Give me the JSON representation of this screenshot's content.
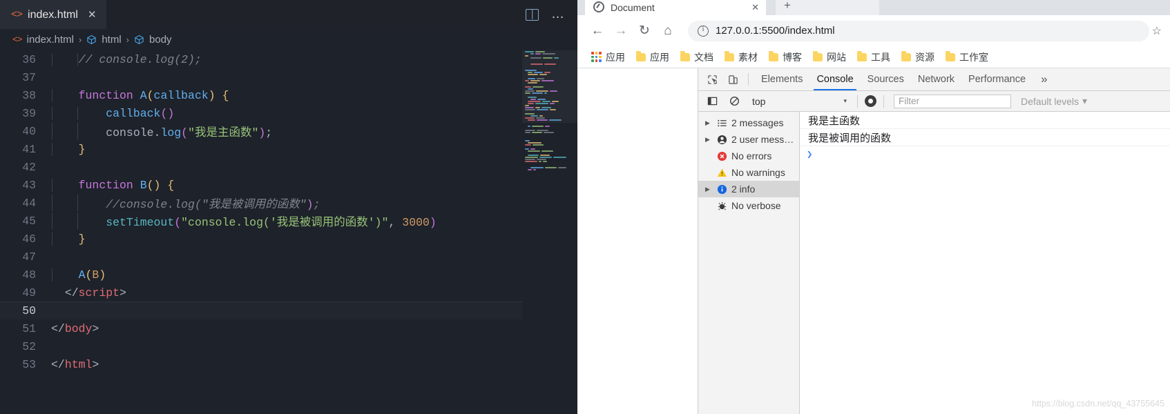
{
  "vscode": {
    "tab": {
      "label": "index.html",
      "icon": "html-file-icon",
      "close": "✕"
    },
    "actions": {
      "split": "split-editor-icon",
      "more": "…"
    },
    "breadcrumb": {
      "file": "index.html",
      "html": "html",
      "body": "body",
      "sep": "›"
    },
    "code_lines": [
      {
        "n": "36",
        "active": false,
        "indent_guides": 2,
        "tokens": [
          {
            "t": "    ",
            "c": "t-plain"
          },
          {
            "t": "// console.log(2);",
            "c": "t-com"
          }
        ]
      },
      {
        "n": "37",
        "active": false,
        "indent_guides": 0,
        "tokens": []
      },
      {
        "n": "38",
        "active": false,
        "indent_guides": 1,
        "tokens": [
          {
            "t": "    ",
            "c": "t-plain"
          },
          {
            "t": "function",
            "c": "t-key"
          },
          {
            "t": " ",
            "c": "t-plain"
          },
          {
            "t": "A",
            "c": "t-fn"
          },
          {
            "t": "(",
            "c": "t-par-y"
          },
          {
            "t": "callback",
            "c": "t-fn"
          },
          {
            "t": ")",
            "c": "t-par-y"
          },
          {
            "t": " ",
            "c": "t-plain"
          },
          {
            "t": "{",
            "c": "t-brace-y"
          }
        ]
      },
      {
        "n": "39",
        "active": false,
        "indent_guides": 2,
        "tokens": [
          {
            "t": "        ",
            "c": "t-plain"
          },
          {
            "t": "callback",
            "c": "t-fn"
          },
          {
            "t": "()",
            "c": "t-mag"
          }
        ]
      },
      {
        "n": "40",
        "active": false,
        "indent_guides": 2,
        "tokens": [
          {
            "t": "        ",
            "c": "t-plain"
          },
          {
            "t": "console",
            "c": "t-plain"
          },
          {
            "t": ".",
            "c": "t-plain"
          },
          {
            "t": "log",
            "c": "t-fn"
          },
          {
            "t": "(",
            "c": "t-mag"
          },
          {
            "t": "\"我是主函数\"",
            "c": "t-str"
          },
          {
            "t": ")",
            "c": "t-mag"
          },
          {
            "t": ";",
            "c": "t-plain"
          }
        ]
      },
      {
        "n": "41",
        "active": false,
        "indent_guides": 1,
        "tokens": [
          {
            "t": "    ",
            "c": "t-plain"
          },
          {
            "t": "}",
            "c": "t-brace-y"
          }
        ]
      },
      {
        "n": "42",
        "active": false,
        "indent_guides": 0,
        "tokens": []
      },
      {
        "n": "43",
        "active": false,
        "indent_guides": 1,
        "tokens": [
          {
            "t": "    ",
            "c": "t-plain"
          },
          {
            "t": "function",
            "c": "t-key"
          },
          {
            "t": " ",
            "c": "t-plain"
          },
          {
            "t": "B",
            "c": "t-fn"
          },
          {
            "t": "()",
            "c": "t-par-y"
          },
          {
            "t": " ",
            "c": "t-plain"
          },
          {
            "t": "{",
            "c": "t-brace-y"
          }
        ]
      },
      {
        "n": "44",
        "active": false,
        "indent_guides": 2,
        "tokens": [
          {
            "t": "        ",
            "c": "t-plain"
          },
          {
            "t": "//console.log(",
            "c": "t-com"
          },
          {
            "t": "\"我是被调用的函数\"",
            "c": "t-com"
          },
          {
            "t": ")",
            "c": "t-mag"
          },
          {
            "t": ";",
            "c": "t-com"
          }
        ]
      },
      {
        "n": "45",
        "active": false,
        "indent_guides": 2,
        "tokens": [
          {
            "t": "        ",
            "c": "t-plain"
          },
          {
            "t": "setTimeout",
            "c": "t-prop"
          },
          {
            "t": "(",
            "c": "t-mag"
          },
          {
            "t": "\"console.log('我是被调用的函数')\"",
            "c": "t-str"
          },
          {
            "t": ", ",
            "c": "t-plain"
          },
          {
            "t": "3000",
            "c": "t-num"
          },
          {
            "t": ")",
            "c": "t-mag"
          }
        ]
      },
      {
        "n": "46",
        "active": false,
        "indent_guides": 1,
        "tokens": [
          {
            "t": "    ",
            "c": "t-plain"
          },
          {
            "t": "}",
            "c": "t-brace-y"
          }
        ]
      },
      {
        "n": "47",
        "active": false,
        "indent_guides": 0,
        "tokens": []
      },
      {
        "n": "48",
        "active": false,
        "indent_guides": 1,
        "tokens": [
          {
            "t": "    ",
            "c": "t-plain"
          },
          {
            "t": "A",
            "c": "t-fn"
          },
          {
            "t": "(",
            "c": "t-par-y"
          },
          {
            "t": "B",
            "c": "t-par"
          },
          {
            "t": ")",
            "c": "t-par-y"
          }
        ]
      },
      {
        "n": "49",
        "active": false,
        "indent_guides": 0,
        "tokens": [
          {
            "t": "  ",
            "c": "t-plain"
          },
          {
            "t": "</",
            "c": "t-punct"
          },
          {
            "t": "script",
            "c": "t-tag"
          },
          {
            "t": ">",
            "c": "t-punct"
          }
        ]
      },
      {
        "n": "50",
        "active": true,
        "indent_guides": 0,
        "tokens": []
      },
      {
        "n": "51",
        "active": false,
        "indent_guides": 0,
        "tokens": [
          {
            "t": "</",
            "c": "t-punct"
          },
          {
            "t": "body",
            "c": "t-tag"
          },
          {
            "t": ">",
            "c": "t-punct"
          }
        ]
      },
      {
        "n": "52",
        "active": false,
        "indent_guides": 0,
        "tokens": []
      },
      {
        "n": "53",
        "active": false,
        "indent_guides": 0,
        "tokens": [
          {
            "t": "</",
            "c": "t-punct"
          },
          {
            "t": "html",
            "c": "t-tag"
          },
          {
            "t": ">",
            "c": "t-punct"
          }
        ]
      }
    ]
  },
  "chrome": {
    "tab": {
      "title": "Document",
      "close": "✕"
    },
    "newtab": "+",
    "nav": {
      "back": "←",
      "forward": "→",
      "reload": "↻",
      "home": "⌂"
    },
    "omnibox": {
      "url": "127.0.0.1:5500/index.html",
      "star": "☆"
    },
    "bookmarks": [
      {
        "label": "应用",
        "icon": "apps-grid-icon"
      },
      {
        "label": "应用",
        "icon": "folder-icon"
      },
      {
        "label": "文档",
        "icon": "folder-icon"
      },
      {
        "label": "素材",
        "icon": "folder-icon"
      },
      {
        "label": "博客",
        "icon": "folder-icon"
      },
      {
        "label": "网站",
        "icon": "folder-icon"
      },
      {
        "label": "工具",
        "icon": "folder-icon"
      },
      {
        "label": "资源",
        "icon": "folder-icon"
      },
      {
        "label": "工作室",
        "icon": "folder-icon"
      }
    ]
  },
  "devtools": {
    "tabs": [
      {
        "label": "Elements",
        "active": false
      },
      {
        "label": "Console",
        "active": true
      },
      {
        "label": "Sources",
        "active": false
      },
      {
        "label": "Network",
        "active": false
      },
      {
        "label": "Performance",
        "active": false
      }
    ],
    "more": "»",
    "toolbar": {
      "inspect": "inspect-element-icon",
      "device": "device-toolbar-icon",
      "sidebar_toggle": "console-sidebar-icon",
      "clear": "clear-console-icon",
      "context": "top",
      "caret": "▾",
      "eye": "live-expression-icon",
      "filter_placeholder": "Filter",
      "levels": "Default levels",
      "levels_caret": "▾"
    },
    "sidebar": [
      {
        "label": "2 messages",
        "icon": "list-icon",
        "expandable": true,
        "selected": false
      },
      {
        "label": "2 user mess…",
        "icon": "user-icon",
        "expandable": true,
        "selected": false
      },
      {
        "label": "No errors",
        "icon": "error-icon",
        "expandable": false,
        "selected": false
      },
      {
        "label": "No warnings",
        "icon": "warning-icon",
        "expandable": false,
        "selected": false
      },
      {
        "label": "2 info",
        "icon": "info-icon",
        "expandable": true,
        "selected": true
      },
      {
        "label": "No verbose",
        "icon": "verbose-icon",
        "expandable": false,
        "selected": false
      }
    ],
    "console_logs": [
      "我是主函数",
      "我是被调用的函数"
    ],
    "prompt": "❯",
    "watermark": "https://blog.csdn.net/qq_43755645"
  },
  "colors": {
    "accent": "#1a73e8",
    "editor_bg": "#1e222a",
    "tab_active_bg": "#292d36",
    "error": "#e53935",
    "warning": "#f5c518",
    "info": "#1565e0",
    "bookmark_folder": "#fcd462"
  }
}
